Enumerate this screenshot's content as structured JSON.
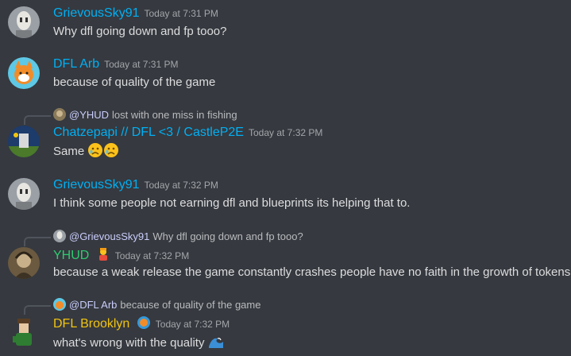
{
  "messages": [
    {
      "author": "GrievousSky91",
      "author_color": "#00b0f4",
      "timestamp": "Today at 7:31 PM",
      "text": "Why dfl going down and fp tooo?"
    },
    {
      "author": "DFL Arb",
      "author_color": "#00b0f4",
      "timestamp": "Today at 7:31 PM",
      "text": "because of quality of the game"
    },
    {
      "author": "Chatzepapi // DFL <3 / CastleP2E",
      "author_color": "#00b0f4",
      "timestamp": "Today at 7:32 PM",
      "text": "Same",
      "reply_to": {
        "author": "@YHUD",
        "text": "lost with one miss in fishing"
      }
    },
    {
      "author": "GrievousSky91",
      "author_color": "#00b0f4",
      "timestamp": "Today at 7:32 PM",
      "text": "I think some people not earning dfl and blueprints its helping that to."
    },
    {
      "author": "YHUD",
      "author_color": "#2ecc71",
      "timestamp": "Today at 7:32 PM",
      "text": "because a weak release the game constantly crashes people have no faith in the growth of tokens",
      "reply_to": {
        "author": "@GrievousSky91",
        "text": "Why dfl going down and fp tooo?"
      }
    },
    {
      "author": "DFL Brooklyn",
      "author_color": "#f1c40f",
      "timestamp": "Today at 7:32 PM",
      "text": "what's wrong with the quality",
      "reply_to": {
        "author": "@DFL Arb",
        "text": "because of quality of the game"
      }
    }
  ],
  "colors": {
    "background": "#36393f",
    "timestamp": "#a3a6aa",
    "text": "#dcddde",
    "reply_name": "#c9cdfb"
  },
  "icons": [
    "general-grievous-avatar",
    "fox-avatar",
    "scene-avatar",
    "portrait-avatar",
    "robot-avatar",
    "crying-emoji",
    "person-emoji",
    "badge-icon",
    "wave-emoji"
  ]
}
